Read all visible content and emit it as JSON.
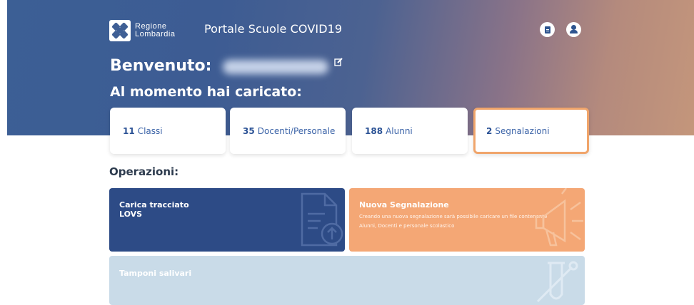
{
  "brand": {
    "logo_line1": "Regione",
    "logo_line2": "Lombardia",
    "portal_title": "Portale Scuole COVID19"
  },
  "header": {
    "welcome_label": "Benvenuto:",
    "loaded_title": "Al momento hai caricato:"
  },
  "stats": [
    {
      "count": "11",
      "label": "Classi"
    },
    {
      "count": "35",
      "label": "Docenti/Personale"
    },
    {
      "count": "188",
      "label": "Alunni"
    },
    {
      "count": "2",
      "label": "Segnalazioni",
      "selected": true
    }
  ],
  "operations": {
    "title": "Operazioni:",
    "tracciato": {
      "title_line1": "Carica tracciato",
      "title_line2": "LOVS"
    },
    "segnalazione": {
      "title": "Nuova Segnalazione",
      "desc_line1": "Creando una nuova segnalazione sarà possibile caricare un file contenente",
      "desc_line2": "Alunni, Docenti e personale scolastico"
    },
    "tamponi": {
      "title": "Tamponi salivari"
    }
  },
  "icons": {
    "logo": "regione-lombardia-logo",
    "top_right": [
      "document-icon",
      "user-icon"
    ],
    "edit": "edit-icon",
    "tracciato": "upload-file-icon",
    "segnalazione": "megaphone-icon",
    "tamponi": "test-tube-icon"
  },
  "colors": {
    "primary": "#2d4b86",
    "accent": "#f4a775",
    "light": "#c9dbe8",
    "selected_border": "#f0a56b"
  }
}
